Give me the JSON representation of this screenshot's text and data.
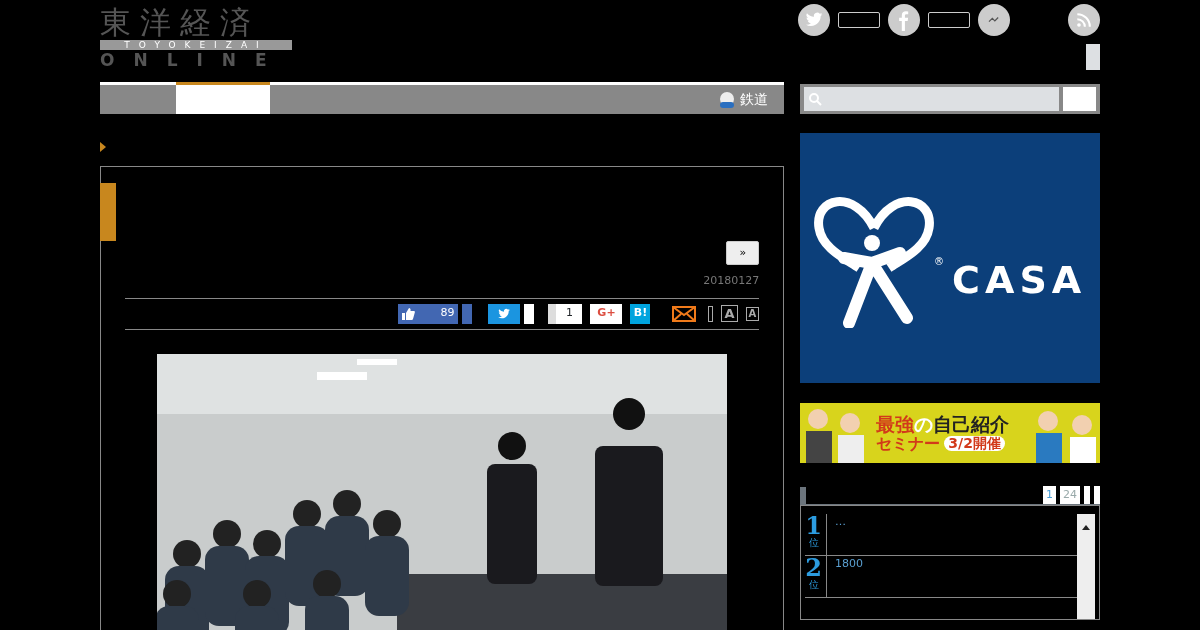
{
  "logo": {
    "kanji": "東洋経済",
    "band": "TOYOKEIZAI",
    "sub": "ONLINE"
  },
  "social": [
    {
      "kind": "twitter"
    },
    {
      "kind": "facebook"
    },
    {
      "kind": "messenger"
    },
    {
      "kind": "rss"
    }
  ],
  "nav": {
    "tabs": [
      {
        "selected": true
      }
    ],
    "rail_link": "鉄道"
  },
  "article": {
    "next_button": "»",
    "date": "20180127",
    "share": [
      {
        "kind": "like",
        "count": "89"
      },
      {
        "kind": "twitter"
      },
      {
        "kind": "count",
        "count": "1"
      },
      {
        "kind": "gplus",
        "label": "G+"
      },
      {
        "kind": "hatena",
        "label": "B!"
      },
      {
        "kind": "mail"
      }
    ],
    "font_buttons": [
      {
        "label": "A",
        "kind": "large"
      },
      {
        "label": "A",
        "kind": "small"
      }
    ]
  },
  "ads": [
    {
      "kind": "casa",
      "brand": "CASA",
      "mark": "®"
    },
    {
      "kind": "seminar",
      "line1a": "最強",
      "line1b": "の",
      "line1c": "自己紹介",
      "line2": "セミナー",
      "date": "3/2開催"
    }
  ],
  "ranking": {
    "tabs": [
      {
        "label": "1",
        "selected": true
      },
      {
        "label": "24",
        "selected": false
      }
    ],
    "items": [
      {
        "rank": "1",
        "unit": "位",
        "title": "…"
      },
      {
        "rank": "2",
        "unit": "位",
        "title": "1800"
      }
    ]
  }
}
